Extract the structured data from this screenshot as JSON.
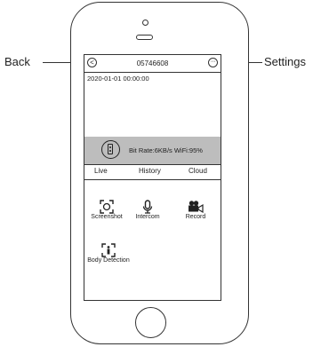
{
  "annotations": {
    "back_label": "Back",
    "settings_label": "Settings"
  },
  "header": {
    "back_icon": "<",
    "title": "05746608",
    "settings_icon": "···"
  },
  "video": {
    "timestamp": "2020-01-01  00:00:00"
  },
  "status": {
    "text": "Bit Rate:6KB/s WiFi:95%"
  },
  "tabs": [
    {
      "label": "Live"
    },
    {
      "label": "History"
    },
    {
      "label": "Cloud"
    }
  ],
  "actions": [
    {
      "label": "Screenshot",
      "icon": "screenshot-icon"
    },
    {
      "label": "Intercom",
      "icon": "microphone-icon"
    },
    {
      "label": "Record",
      "icon": "video-camera-icon"
    },
    {
      "label": "Body Detection",
      "icon": "body-detection-icon"
    }
  ]
}
